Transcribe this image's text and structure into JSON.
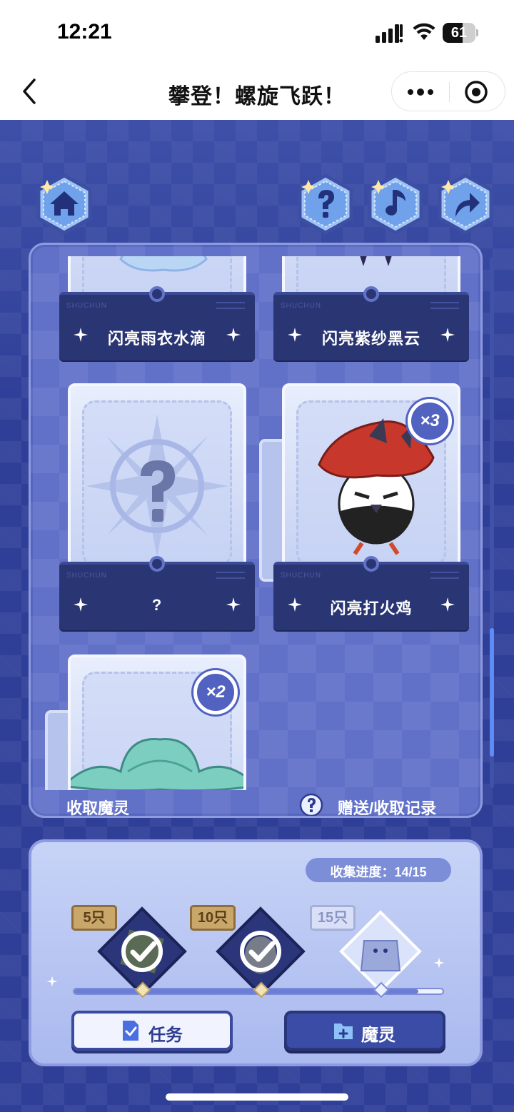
{
  "status_bar": {
    "time": "12:21",
    "battery": "61",
    "battery_level": 0.61
  },
  "nav": {
    "title": "攀登！螺旋飞跃！"
  },
  "icons": {
    "home": "home-icon",
    "help": "question-icon",
    "music": "music-note-icon",
    "share": "share-arrow-icon"
  },
  "cards": [
    {
      "label": "闪亮雨衣水滴",
      "count": ""
    },
    {
      "label": "闪亮紫纱黑云",
      "count": ""
    },
    {
      "label": "?",
      "count": ""
    },
    {
      "label": "闪亮打火鸡",
      "count": "×3"
    },
    {
      "label": "",
      "count": "×2"
    }
  ],
  "panel_links": {
    "collect": "收取魔灵",
    "record": "赠送/收取记录"
  },
  "progress": {
    "label": "收集进度：",
    "value": "14/15",
    "collected": 14,
    "total": 15,
    "milestones": [
      {
        "tag": "5只",
        "claimed": true
      },
      {
        "tag": "10只",
        "claimed": true
      },
      {
        "tag": "15只",
        "claimed": false
      }
    ]
  },
  "buttons": {
    "task": "任务",
    "spirit": "魔灵"
  },
  "colors": {
    "background": "#2f3f98",
    "panel": "#6171c8",
    "sleeve": "#2a3674",
    "accent": "#5262c1"
  }
}
